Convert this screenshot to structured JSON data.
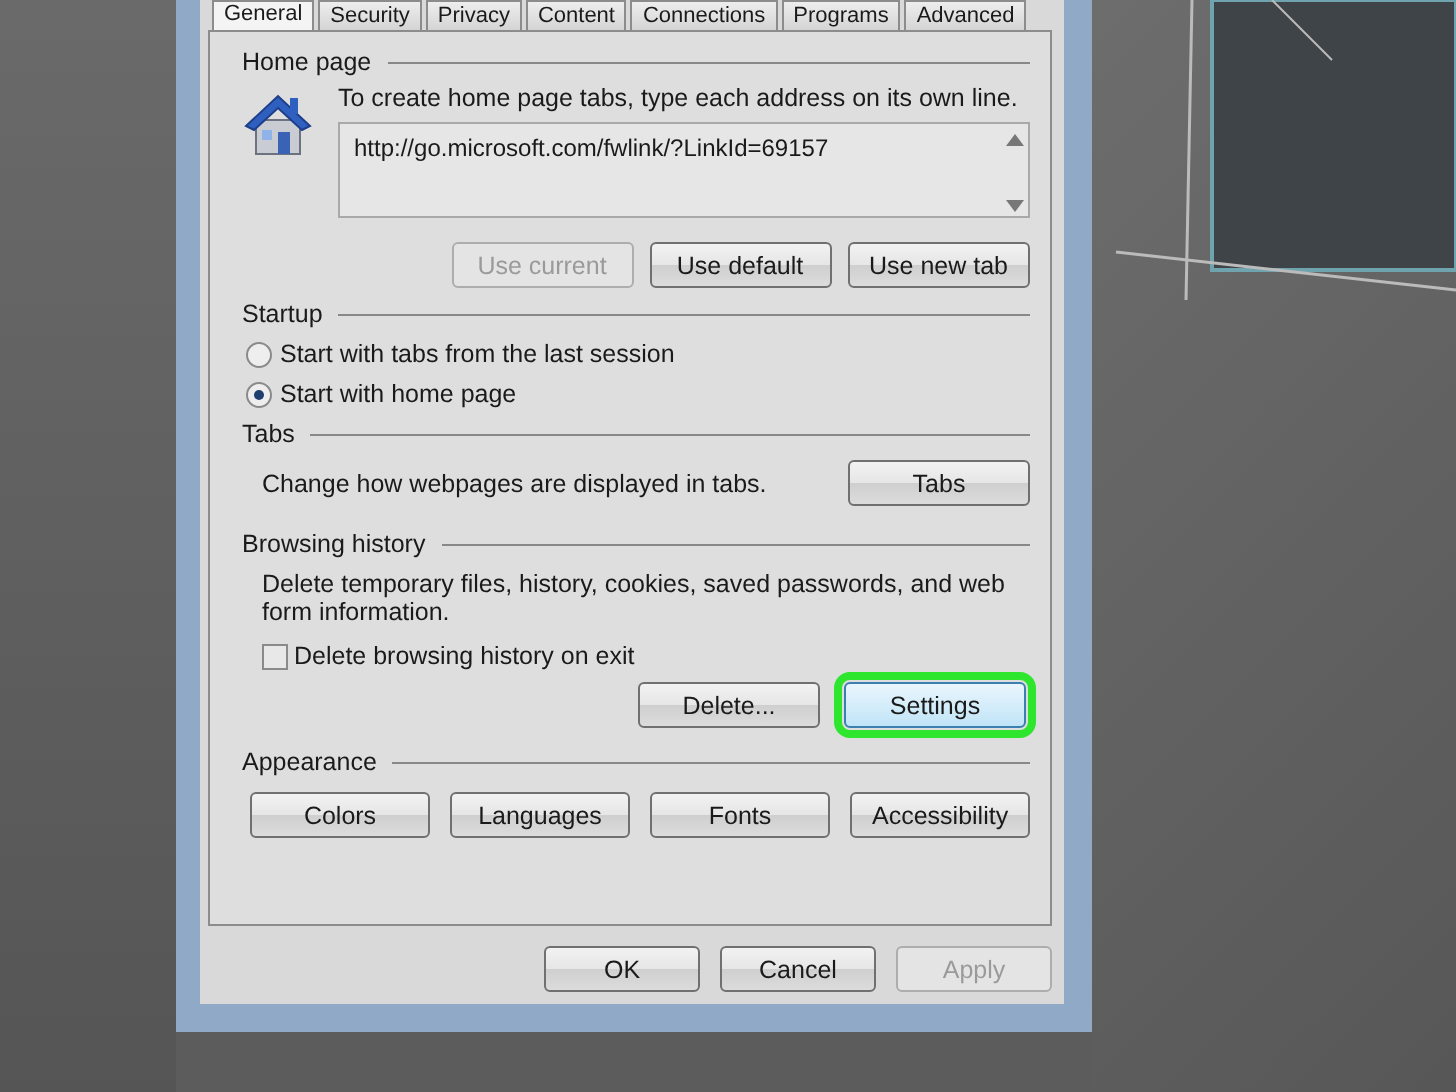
{
  "tabs": [
    {
      "label": "General",
      "selected": true
    },
    {
      "label": "Security",
      "selected": false
    },
    {
      "label": "Privacy",
      "selected": false
    },
    {
      "label": "Content",
      "selected": false
    },
    {
      "label": "Connections",
      "selected": false
    },
    {
      "label": "Programs",
      "selected": false
    },
    {
      "label": "Advanced",
      "selected": false
    }
  ],
  "home_page": {
    "title": "Home page",
    "instruction": "To create home page tabs, type each address on its own line.",
    "addresses": "http://go.microsoft.com/fwlink/?LinkId=69157",
    "buttons": [
      {
        "label": "Use current",
        "disabled": true
      },
      {
        "label": "Use default",
        "disabled": false
      },
      {
        "label": "Use new tab",
        "disabled": false
      }
    ]
  },
  "startup": {
    "title": "Startup",
    "options": [
      {
        "label": "Start with tabs from the last session",
        "selected": false
      },
      {
        "label": "Start with home page",
        "selected": true
      }
    ]
  },
  "tabs_section": {
    "title": "Tabs",
    "description": "Change how webpages are displayed in tabs.",
    "button": "Tabs"
  },
  "browsing_history": {
    "title": "Browsing history",
    "description": "Delete temporary files, history, cookies, saved passwords, and web form information.",
    "delete_on_exit": {
      "label": "Delete browsing history on exit",
      "checked": false
    },
    "buttons": [
      {
        "label": "Delete...",
        "highlighted": false
      },
      {
        "label": "Settings",
        "highlighted": true
      }
    ]
  },
  "appearance": {
    "title": "Appearance",
    "buttons": [
      "Colors",
      "Languages",
      "Fonts",
      "Accessibility"
    ]
  },
  "dialog_buttons": [
    {
      "label": "OK",
      "disabled": false
    },
    {
      "label": "Cancel",
      "disabled": false
    },
    {
      "label": "Apply",
      "disabled": true
    }
  ]
}
